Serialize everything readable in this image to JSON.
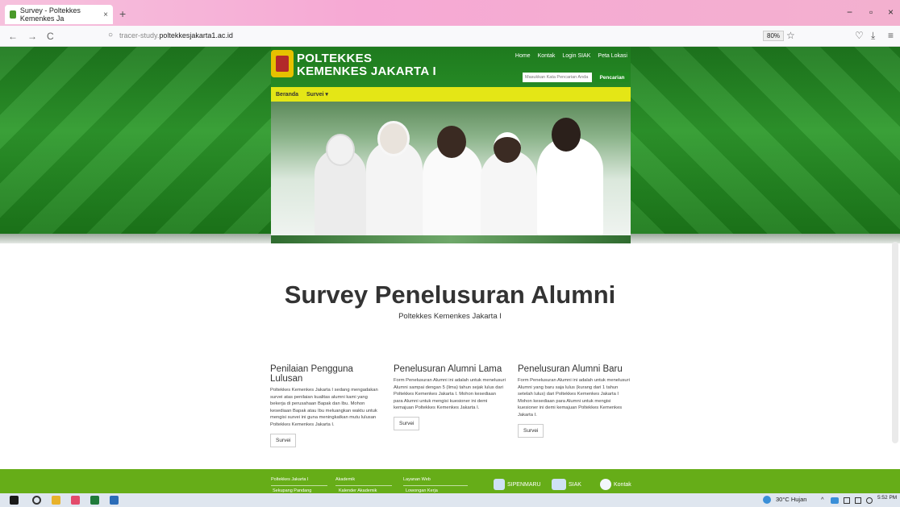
{
  "browser": {
    "tab_title": "Survey - Poltekkes Kemenkes Ja",
    "tab_close": "×",
    "new_tab": "+",
    "url_prefix": "tracer-study.",
    "url_domain": "poltekkesjakarta1.ac.id",
    "zoom": "80%",
    "back_icon": "←",
    "forward_icon": "→",
    "reload_icon": "C",
    "shield_icon": "○",
    "lock_icon": "🔒",
    "star_icon": "☆",
    "pocket_icon": "♡",
    "download_icon": "⤓",
    "menu_icon": "≡",
    "minimize": "−",
    "restore": "▫",
    "close": "×"
  },
  "header": {
    "brand_line1": "POLTEKKES",
    "brand_line2": "KEMENKES JAKARTA I",
    "top_links": [
      "Home",
      "Kontak",
      "Login SIAK",
      "Peta Lokasi"
    ],
    "search_placeholder": "Masukkan Kata Pencarian Anda",
    "search_button": "Pencarian",
    "menu": [
      "Beranda",
      "Survei ▾"
    ]
  },
  "main": {
    "title": "Survey Penelusuran Alumni",
    "subtitle": "Poltekkes Kemenkes Jakarta I",
    "columns": [
      {
        "heading": "Penilaian Pengguna Lulusan",
        "text": "Poltekkes Kemenkes Jakarta I sedang mengadakan survei atas penilaian kualitas alumni kami yang bekerja di perusahaan Bapak dan Ibu. Mohon kesediaan Bapak atau Ibu meluangkan waktu untuk mengisi survei ini guna meningkatkan mutu lulusan Poltekkes Kemenkes Jakarta I.",
        "button": "Survei"
      },
      {
        "heading": "Penelusuran Alumni Lama",
        "text": "Form Penelusuran Alumni ini adalah untuk menelusuri Alumni sampai dengan 5 (lima) tahun sejak lulus dari Poltekkes Kemenkes Jakarta I. Mohon kesediaan para Alumni untuk mengisi kuesioner ini demi kemajuan Poltekkes Kemenkes Jakarta I.",
        "button": "Survei"
      },
      {
        "heading": "Penelusuran Alumni Baru",
        "text": "Form Penelusuran Alumni ini adalah untuk menelusuri Alumni yang baru saja lulus (kurang dari 1 tahun setelah lulus) dari Poltekkes Kemenkes Jakarta I Mohon kesediaan para Alumni untuk mengisi kuesioner ini demi kemajuan Poltekkes Kemenkes Jakarta I.",
        "button": "Survei"
      }
    ]
  },
  "footer": {
    "col1": [
      "Poltekkes Jakarta I",
      "Sekupang Pandang"
    ],
    "col2": [
      "Akademik",
      "Kalender Akademik"
    ],
    "col3": [
      "Layanan Web",
      "Lowongan Kerja"
    ],
    "buttons": [
      "SIPENMARU",
      "SIAK",
      "Kontak"
    ]
  },
  "taskbar": {
    "weather": "30°C Hujan",
    "time": "5:52 PM"
  }
}
